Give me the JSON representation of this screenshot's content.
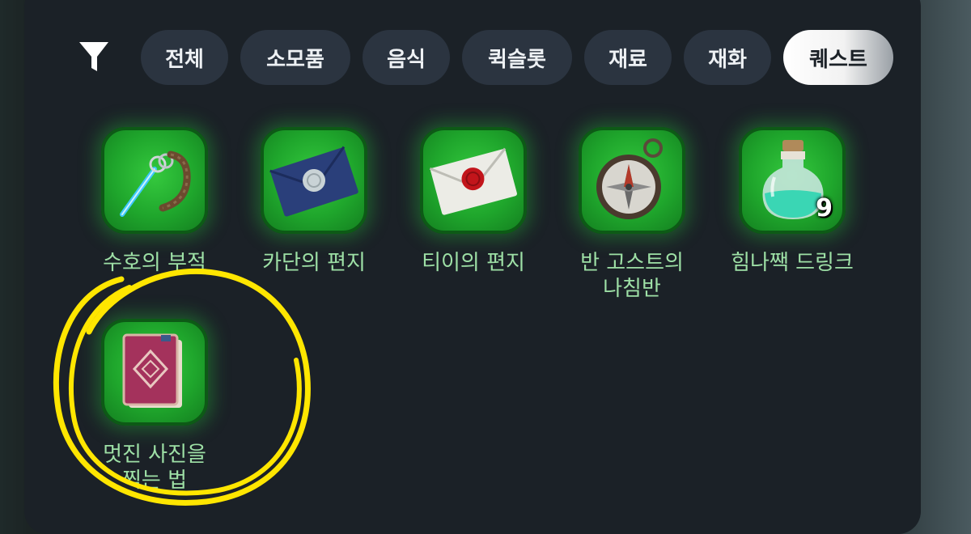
{
  "filter": {
    "icon": "filter-icon"
  },
  "tabs": [
    {
      "label": "전체",
      "active": false
    },
    {
      "label": "소모품",
      "active": false
    },
    {
      "label": "음식",
      "active": false
    },
    {
      "label": "퀵슬롯",
      "active": false
    },
    {
      "label": "재료",
      "active": false
    },
    {
      "label": "재화",
      "active": false
    },
    {
      "label": "퀘스트",
      "active": true
    }
  ],
  "items": [
    {
      "name": "수호의 부적",
      "icon": "amulet-icon",
      "count": ""
    },
    {
      "name": "카단의 편지",
      "icon": "blue-letter-icon",
      "count": ""
    },
    {
      "name": "티이의 편지",
      "icon": "white-letter-icon",
      "count": ""
    },
    {
      "name": "반 고스트의\n나침반",
      "icon": "compass-icon",
      "count": ""
    },
    {
      "name": "힘나짹 드링크",
      "icon": "potion-icon",
      "count": "9"
    },
    {
      "name": "멋진 사진을\n찍는 법",
      "icon": "book-icon",
      "count": ""
    }
  ],
  "colors": {
    "panel": "#1b2127",
    "tab": "#2b3440",
    "slot_green": "#1fa62c",
    "label_green": "#9ee0a6",
    "highlight_yellow": "#ffe600"
  }
}
